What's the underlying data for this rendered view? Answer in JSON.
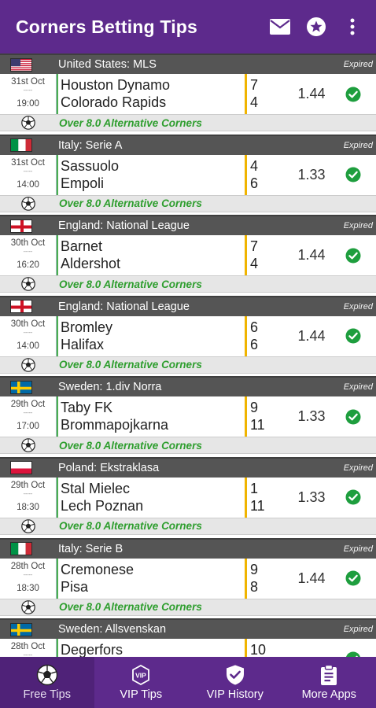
{
  "app": {
    "title": "Corners Betting Tips"
  },
  "colors": {
    "primary": "#5d2a8c",
    "league_bg": "#555555",
    "tip_green": "#2e9e2e",
    "check_green": "#1e9e3e"
  },
  "toolbar": {
    "icons": [
      "mail-icon",
      "star-icon",
      "more-vert-icon"
    ]
  },
  "matches": [
    {
      "flag": "us",
      "league": "United States: MLS",
      "status": "Expired",
      "date": "31st Oct",
      "dash": "-----",
      "time": "19:00",
      "home": "Houston Dynamo",
      "away": "Colorado Rapids",
      "home_score": "7",
      "away_score": "4",
      "odds": "1.44",
      "tip": "Over 8.0 Alternative Corners"
    },
    {
      "flag": "it",
      "league": "Italy: Serie A",
      "status": "Expired",
      "date": "31st Oct",
      "dash": "-----",
      "time": "14:00",
      "home": "Sassuolo",
      "away": "Empoli",
      "home_score": "4",
      "away_score": "6",
      "odds": "1.33",
      "tip": "Over 8.0 Alternative Corners"
    },
    {
      "flag": "en",
      "league": "England: National League",
      "status": "Expired",
      "date": "30th Oct",
      "dash": "-----",
      "time": "16:20",
      "home": "Barnet",
      "away": "Aldershot",
      "home_score": "7",
      "away_score": "4",
      "odds": "1.44",
      "tip": "Over 8.0 Alternative Corners"
    },
    {
      "flag": "en",
      "league": "England: National League",
      "status": "Expired",
      "date": "30th Oct",
      "dash": "-----",
      "time": "14:00",
      "home": "Bromley",
      "away": "Halifax",
      "home_score": "6",
      "away_score": "6",
      "odds": "1.44",
      "tip": "Over 8.0 Alternative Corners"
    },
    {
      "flag": "se",
      "league": "Sweden: 1.div Norra",
      "status": "Expired",
      "date": "29th Oct",
      "dash": "-----",
      "time": "17:00",
      "home": "Taby FK",
      "away": "Brommapojkarna",
      "home_score": "9",
      "away_score": "11",
      "odds": "1.33",
      "tip": "Over 8.0 Alternative Corners"
    },
    {
      "flag": "pl",
      "league": "Poland: Ekstraklasa",
      "status": "Expired",
      "date": "29th Oct",
      "dash": "-----",
      "time": "18:30",
      "home": "Stal Mielec",
      "away": "Lech Poznan",
      "home_score": "1",
      "away_score": "11",
      "odds": "1.33",
      "tip": "Over 8.0 Alternative Corners"
    },
    {
      "flag": "it",
      "league": "Italy: Serie B",
      "status": "Expired",
      "date": "28th Oct",
      "dash": "-----",
      "time": "18:30",
      "home": "Cremonese",
      "away": "Pisa",
      "home_score": "9",
      "away_score": "8",
      "odds": "1.44",
      "tip": "Over 8.0 Alternative Corners"
    },
    {
      "flag": "se",
      "league": "Sweden: Allsvenskan",
      "status": "Expired",
      "date": "28th Oct",
      "dash": "-----",
      "time": "",
      "home": "Degerfors",
      "away": "",
      "home_score": "10",
      "away_score": "",
      "odds": "",
      "tip": ""
    }
  ],
  "nav": [
    {
      "label": "Free Tips",
      "icon": "soccer-ball-icon",
      "active": true
    },
    {
      "label": "VIP Tips",
      "icon": "vip-badge-icon",
      "active": false
    },
    {
      "label": "VIP History",
      "icon": "shield-check-icon",
      "active": false
    },
    {
      "label": "More Apps",
      "icon": "clipboard-icon",
      "active": false
    }
  ]
}
